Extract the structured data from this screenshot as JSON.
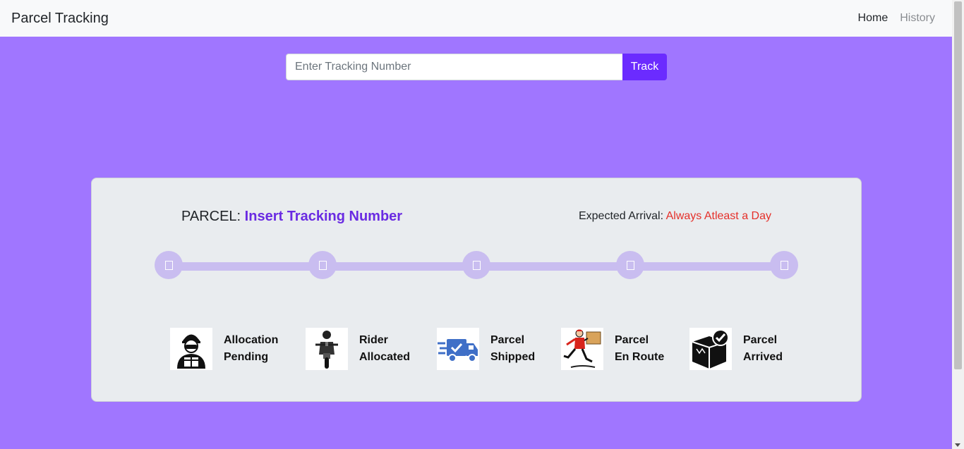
{
  "nav": {
    "brand": "Parcel Tracking",
    "links": [
      {
        "label": "Home"
      },
      {
        "label": "History"
      }
    ]
  },
  "search": {
    "placeholder": "Enter Tracking Number",
    "value": "",
    "button_label": "Track"
  },
  "card": {
    "parcel_label": "PARCEL:",
    "parcel_value": "Insert Tracking Number",
    "arrival_label": "Expected Arrival:",
    "arrival_value": "Always Atleast a Day"
  },
  "stages": [
    {
      "line1": "Allocation",
      "line2": "Pending",
      "icon": "courier-with-box-icon"
    },
    {
      "line1": "Rider",
      "line2": "Allocated",
      "icon": "motorcycle-rider-icon"
    },
    {
      "line1": "Parcel",
      "line2": "Shipped",
      "icon": "delivery-truck-icon"
    },
    {
      "line1": "Parcel",
      "line2": "En Route",
      "icon": "running-courier-icon"
    },
    {
      "line1": "Parcel",
      "line2": "Arrived",
      "icon": "box-checkmark-icon"
    }
  ],
  "colors": {
    "background": "#a076ff",
    "accent": "#6b2bff",
    "parcel_value": "#6a2be2",
    "arrival_value": "#e5302a",
    "progress": "#c9bdf0"
  }
}
